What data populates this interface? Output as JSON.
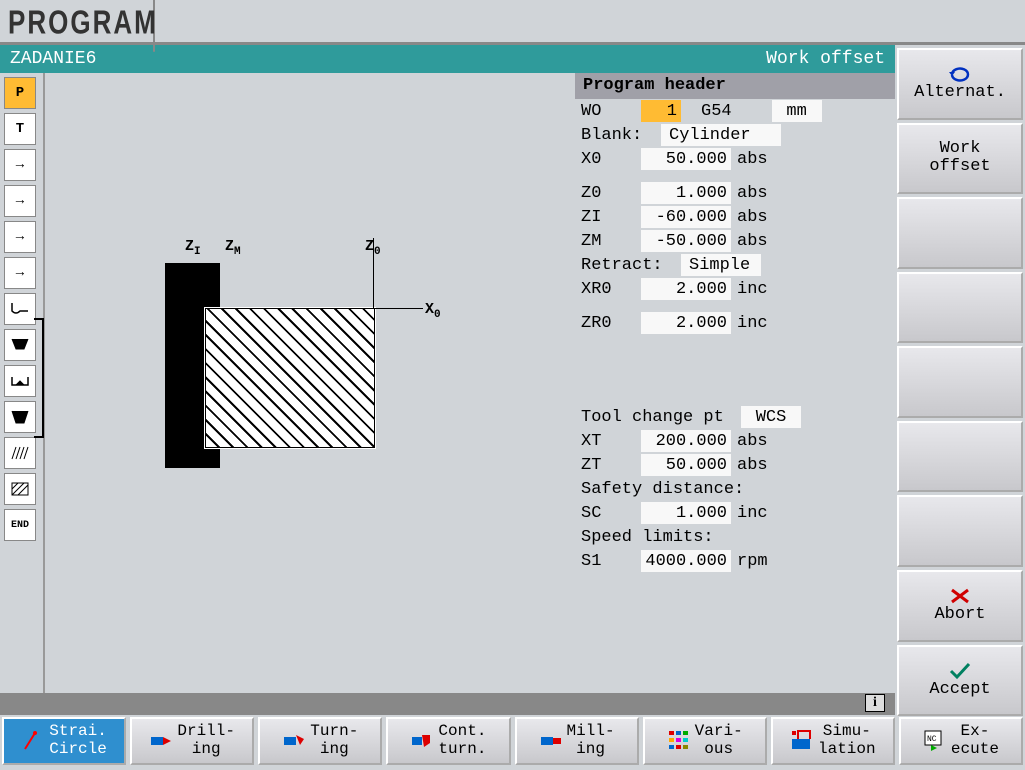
{
  "header": {
    "title": "PROGRAM"
  },
  "titlebar": {
    "program_name": "ZADANIE6",
    "mode": "Work offset"
  },
  "icons": {
    "p": "P",
    "t": "T",
    "arrow": "→",
    "end": "END"
  },
  "params": {
    "header": "Program header",
    "wo_label": "WO",
    "wo_value": "1",
    "wo_code": "G54",
    "wo_unit": "mm",
    "blank_label": "Blank:",
    "blank_value": "Cylinder",
    "x0_label": "X0",
    "x0_value": "50.000",
    "x0_unit": "abs",
    "z0_label": "Z0",
    "z0_value": "1.000",
    "z0_unit": "abs",
    "zi_label": "ZI",
    "zi_value": "-60.000",
    "zi_unit": "abs",
    "zm_label": "ZM",
    "zm_value": "-50.000",
    "zm_unit": "abs",
    "retract_label": "Retract:",
    "retract_value": "Simple",
    "xr0_label": "XR0",
    "xr0_value": "2.000",
    "xr0_unit": "inc",
    "zr0_label": "ZR0",
    "zr0_value": "2.000",
    "zr0_unit": "inc",
    "toolchg_label": "Tool change pt",
    "toolchg_value": "WCS",
    "xt_label": "XT",
    "xt_value": "200.000",
    "xt_unit": "abs",
    "zt_label": "ZT",
    "zt_value": "50.000",
    "zt_unit": "abs",
    "safety_label": "Safety distance:",
    "sc_label": "SC",
    "sc_value": "1.000",
    "sc_unit": "inc",
    "speed_label": "Speed limits:",
    "s1_label": "S1",
    "s1_value": "4000.000",
    "s1_unit": "rpm"
  },
  "rbuttons": {
    "alternat": "Alternat.",
    "work_offset1": "Work",
    "work_offset2": "offset",
    "abort": "Abort",
    "accept": "Accept"
  },
  "footer": {
    "strai1": "Strai.",
    "strai2": "Circle",
    "drill": "Drill-\ning",
    "turn": "Turn-\ning",
    "cont": "Cont.\nturn.",
    "mill": "Mill-\ning",
    "vari": "Vari-\nous",
    "simu": "Simu-\nlation",
    "exec": "Ex-\necute"
  },
  "diagram": {
    "zi": "Z",
    "zi_sub": "I",
    "zm": "Z",
    "zm_sub": "M",
    "z0": "Z",
    "z0_sub": "0",
    "x0": "X",
    "x0_sub": "0"
  }
}
